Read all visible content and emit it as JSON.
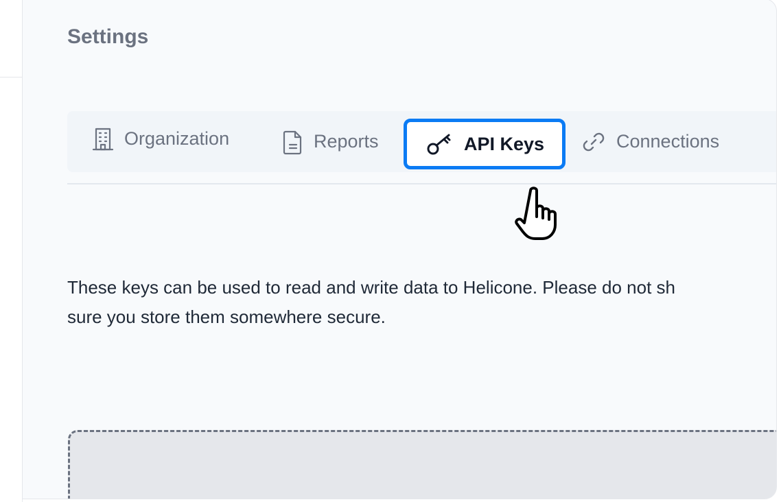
{
  "page": {
    "title": "Settings"
  },
  "tabs": [
    {
      "label": "Organization",
      "icon": "building-icon",
      "active": false
    },
    {
      "label": "Reports",
      "icon": "document-icon",
      "active": false
    },
    {
      "label": "API Keys",
      "icon": "key-icon",
      "active": true
    },
    {
      "label": "Connections",
      "icon": "link-icon",
      "active": false
    }
  ],
  "content": {
    "description_line1": "These keys can be used to read and write data to Helicone. Please do not sh",
    "description_line2": "sure you store them somewhere secure."
  },
  "colors": {
    "accent": "#0b7bf4",
    "panel_background": "#f8fafc",
    "muted_text": "#6b7280",
    "body_text": "#1f2937"
  },
  "cursor": {
    "icon": "hand-pointer-cursor-icon"
  }
}
